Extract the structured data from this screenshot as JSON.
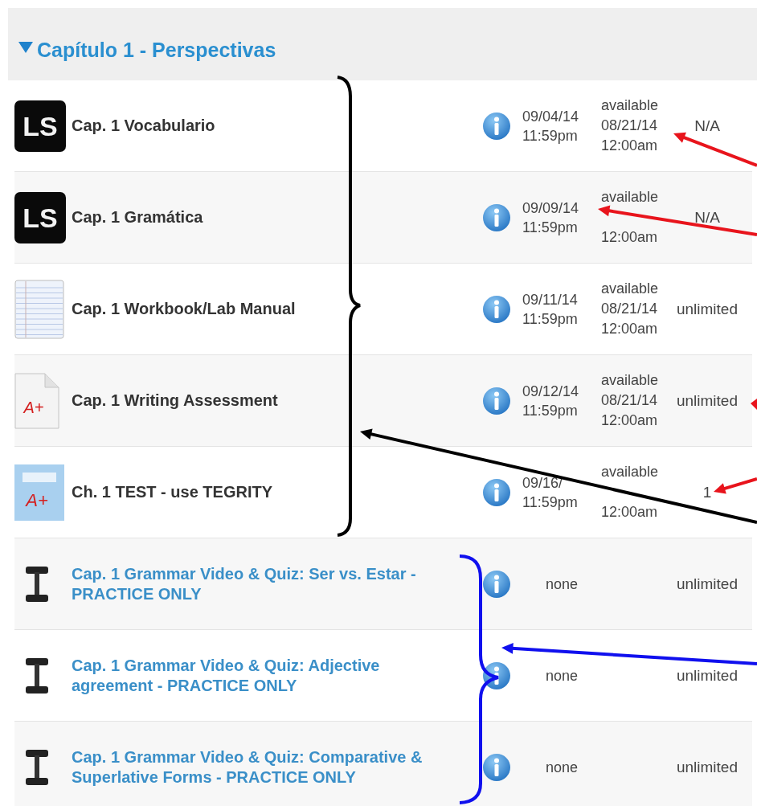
{
  "section": {
    "title": "Capítulo 1 - Perspectivas",
    "expanded": true
  },
  "rows": [
    {
      "kind": "ls",
      "icon_label": "LS",
      "title": "Cap. 1 Vocabulario",
      "due": [
        "09/04/14",
        "11:59pm"
      ],
      "available": {
        "label": "available",
        "date": "08/21/14",
        "time": "12:00am"
      },
      "attempts": "N/A"
    },
    {
      "kind": "ls",
      "icon_label": "LS",
      "title": "Cap. 1 Gramática",
      "due": [
        "09/09/14",
        "11:59pm"
      ],
      "available": {
        "label": "available",
        "time": "12:00am"
      },
      "attempts": "N/A"
    },
    {
      "kind": "notebook",
      "title": "Cap. 1 Workbook/Lab Manual",
      "due": [
        "09/11/14",
        "11:59pm"
      ],
      "available": {
        "label": "available",
        "date": "08/21/14",
        "time": "12:00am"
      },
      "attempts": "unlimited"
    },
    {
      "kind": "paper",
      "icon_label": "A+",
      "title": "Cap. 1 Writing Assessment",
      "due": [
        "09/12/14",
        "11:59pm"
      ],
      "available": {
        "label": "available",
        "date": "08/21/14",
        "time": "12:00am"
      },
      "attempts": "unlimited"
    },
    {
      "kind": "test",
      "icon_label": "A+",
      "title": "Ch. 1 TEST - use TEGRITY",
      "due": [
        "09/16/",
        "11:59pm"
      ],
      "available": {
        "label": "available",
        "time": "12:00am"
      },
      "attempts": "1"
    },
    {
      "kind": "practice",
      "title": "Cap. 1 Grammar Video & Quiz: Ser vs. Estar - PRACTICE ONLY",
      "due": [
        "none"
      ],
      "attempts": "unlimited"
    },
    {
      "kind": "practice",
      "title": "Cap. 1 Grammar Video & Quiz: Adjective agreement - PRACTICE ONLY",
      "due": [
        "none"
      ],
      "attempts": "unlimited"
    },
    {
      "kind": "practice",
      "title": "Cap. 1 Grammar Video & Quiz: Comparative & Superlative Forms - PRACTICE ONLY",
      "due": [
        "none"
      ],
      "attempts": "unlimited"
    }
  ]
}
